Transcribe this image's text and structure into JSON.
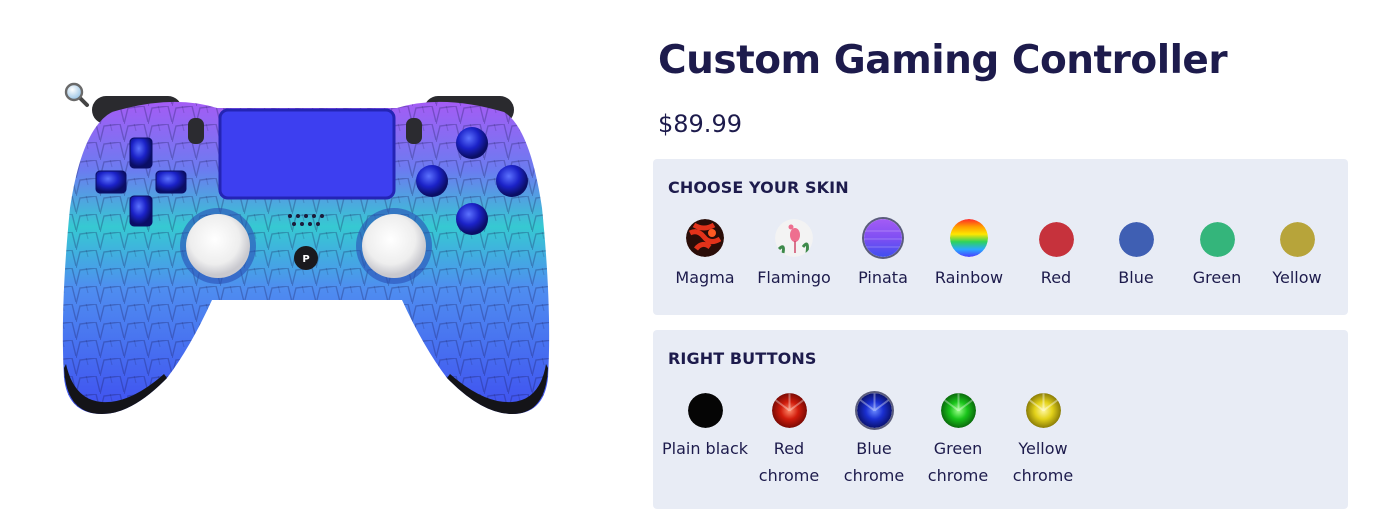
{
  "product": {
    "title": "Custom Gaming Controller",
    "price": "$89.99"
  },
  "image": {
    "zoom_icon": "magnifier-icon",
    "logo_icon": "playstation-logo-icon",
    "colors": {
      "top": "#a45cf5",
      "middle": "#36c9d2",
      "bottom": "#3f4ff0",
      "sticks": "#f2f2f4",
      "buttons": "#1b22c8"
    }
  },
  "skin": {
    "title": "CHOOSE YOUR SKIN",
    "options": [
      {
        "label": "Magma",
        "color": "#b52a14"
      },
      {
        "label": "Flamingo",
        "color": "#eeeeee"
      },
      {
        "label": "Pinata",
        "color": "#7b55f2",
        "selected": true
      },
      {
        "label": "Rainbow",
        "color": "#ff9d00"
      },
      {
        "label": "Red",
        "color": "#c6323c"
      },
      {
        "label": "Blue",
        "color": "#3f5fb3"
      },
      {
        "label": "Green",
        "color": "#34b57b"
      },
      {
        "label": "Yellow",
        "color": "#b7a43a"
      }
    ]
  },
  "right_buttons": {
    "title": "RIGHT BUTTONS",
    "options": [
      {
        "label": "Plain black",
        "color": "#050505"
      },
      {
        "label": "Red chrome",
        "color": "#d11c0c"
      },
      {
        "label": "Blue chrome",
        "color": "#1a2fd1",
        "selected": true
      },
      {
        "label": "Green chrome",
        "color": "#19c41a"
      },
      {
        "label": "Yellow chrome",
        "color": "#e3d21a"
      }
    ]
  }
}
